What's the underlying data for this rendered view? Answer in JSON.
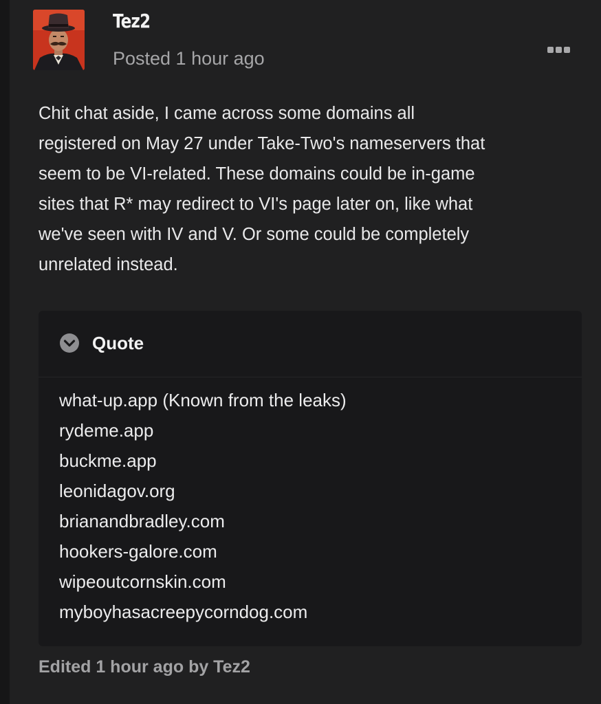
{
  "post": {
    "author": "Tez2",
    "posted_time": "Posted 1 hour ago",
    "menu_icon": "ellipsis-icon",
    "body_lines": [
      "Chit chat aside, I came across some domains all",
      "registered on May 27 under Take-Two's nameservers that",
      "seem to be VI-related. These domains could be in-game",
      "sites that R* may redirect to VI's page later on, like what",
      "we've seen with IV and V. Or some could be completely",
      "unrelated instead."
    ],
    "quote": {
      "label": "Quote",
      "toggle_icon": "chevron-down-circle-icon",
      "lines": [
        "what-up.app (Known from the leaks)",
        "rydeme.app",
        "buckme.app",
        "leonidagov.org",
        "brianandbradley.com",
        "hookers-galore.com",
        "wipeoutcornskin.com",
        "myboyhasacreepycorndog.com"
      ]
    },
    "edited_note": "Edited 1 hour ago by Tez2"
  },
  "colors": {
    "page_background": "#202021",
    "quote_background": "#18181a",
    "muted_text": "#a6a6a8",
    "avatar_background": "#c8341e"
  }
}
